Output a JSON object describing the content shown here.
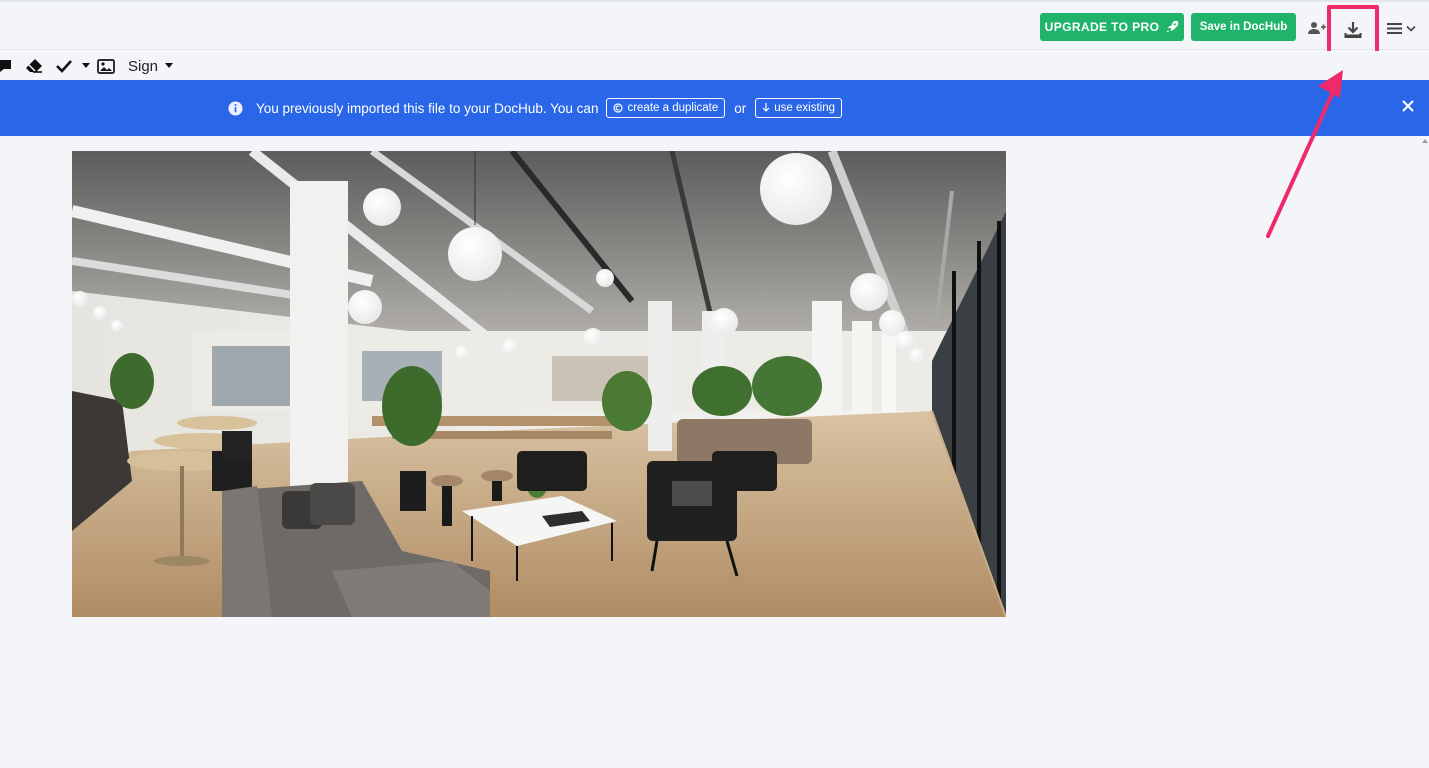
{
  "header": {
    "upgrade_label": "UPGRADE TO PRO",
    "save_label": "Save in DocHub"
  },
  "toolbar": {
    "sign_label": "Sign"
  },
  "banner": {
    "message": "You previously imported this file to your DocHub.  You can",
    "duplicate_label": "create a duplicate",
    "or_label": "or",
    "existing_label": "use existing"
  },
  "colors": {
    "green_button": "#1fb46a",
    "banner_blue": "#2a66e8",
    "highlight_pink": "#ee2a6b"
  },
  "icons": [
    "comment-icon",
    "eraser-icon",
    "checkmark-icon",
    "image-icon",
    "rocket-icon",
    "add-user-icon",
    "download-icon",
    "hamburger-menu-icon",
    "info-icon",
    "close-icon"
  ]
}
